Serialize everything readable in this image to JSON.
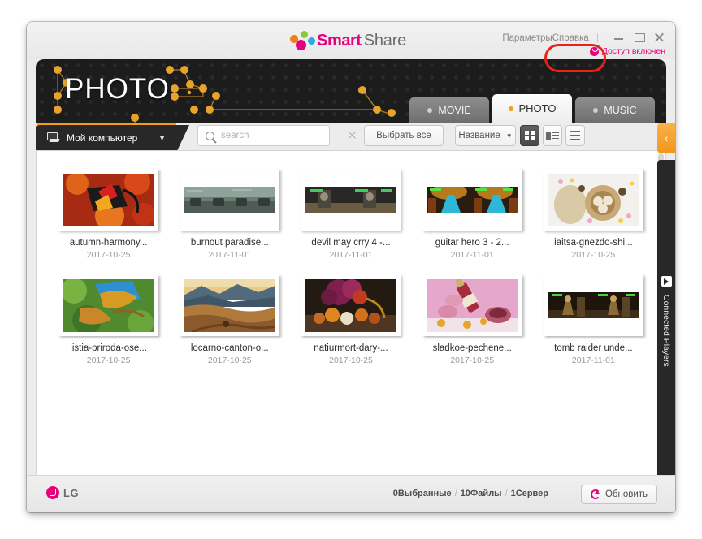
{
  "app": {
    "brand_smart": "Smart",
    "brand_share": "Share",
    "accent_orange": "#f49b1c",
    "accent_pink": "#e6007e",
    "highlight_color": "#e8241a"
  },
  "titlebar": {
    "settings_label": "Параметры",
    "help_label": "Справка",
    "separator": "|",
    "access_status": "Доступ включен",
    "minimize_label": "—",
    "maximize_label": "□",
    "close_label": "×"
  },
  "banner": {
    "title": "PHOTO"
  },
  "tabs": [
    {
      "label": "MOVIE",
      "active": false
    },
    {
      "label": "PHOTO",
      "active": true
    },
    {
      "label": "MUSIC",
      "active": false
    }
  ],
  "toolbar": {
    "source_label": "Мой компьютер",
    "source_caret": "▼",
    "search_placeholder": "search",
    "search_value": "",
    "select_all_label": "Выбрать все",
    "sort_label": "Название",
    "sort_caret": "▼",
    "view_modes": [
      "grid-view",
      "detail-view",
      "list-view"
    ],
    "active_view": "grid-view"
  },
  "items": [
    {
      "name": "autumn-harmony...",
      "date": "2017-10-25",
      "shape": "tall"
    },
    {
      "name": "burnout paradise...",
      "date": "2017-11-01",
      "shape": "wide"
    },
    {
      "name": "devil may crry 4 -...",
      "date": "2017-11-01",
      "shape": "wide"
    },
    {
      "name": "guitar hero 3 - 2...",
      "date": "2017-11-01",
      "shape": "wide"
    },
    {
      "name": "iaitsa-gnezdo-shi...",
      "date": "2017-10-25",
      "shape": "tall"
    },
    {
      "name": "listia-priroda-ose...",
      "date": "2017-10-25",
      "shape": "tall"
    },
    {
      "name": "locarno-canton-o...",
      "date": "2017-10-25",
      "shape": "tall"
    },
    {
      "name": "natiurmort-dary-...",
      "date": "2017-10-25",
      "shape": "tall"
    },
    {
      "name": "sladkoe-pechene...",
      "date": "2017-10-25",
      "shape": "tall"
    },
    {
      "name": "tomb raider unde...",
      "date": "2017-11-01",
      "shape": "wide"
    }
  ],
  "rail": {
    "toggle_label": "‹",
    "label": "Connected Players"
  },
  "statusbar": {
    "brand": "LG",
    "selected": "0Выбранные",
    "files": "10Файлы",
    "servers": "1Сервер",
    "sep": "/",
    "refresh_label": "Обновить"
  }
}
